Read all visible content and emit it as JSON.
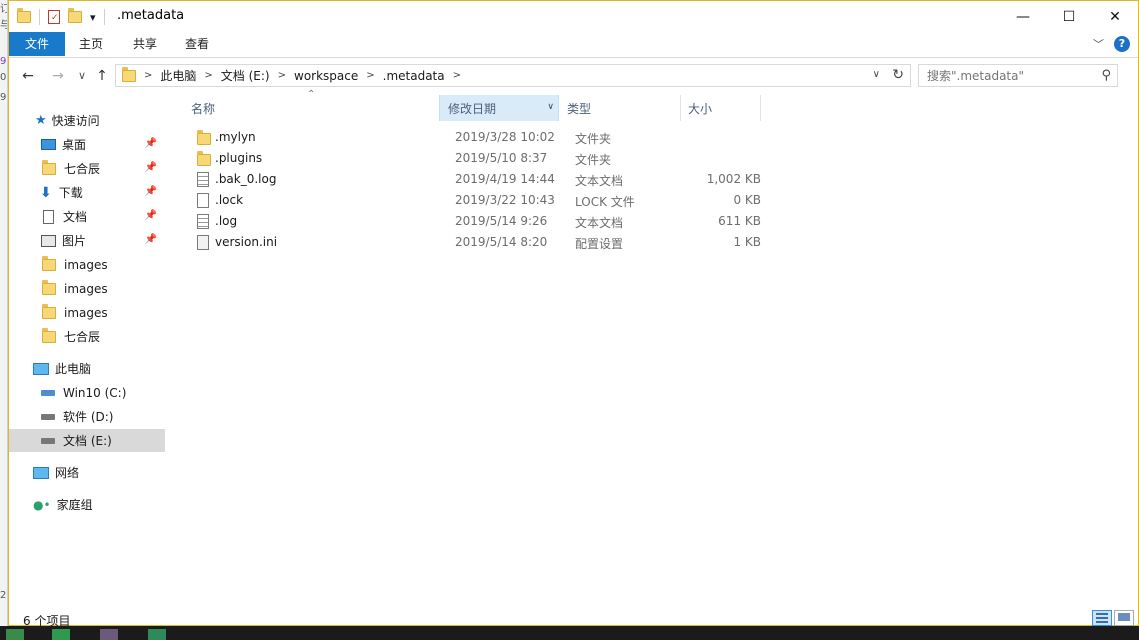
{
  "window": {
    "title": ".metadata",
    "controls": {
      "minimize": "—",
      "maximize": "☐",
      "close": "✕"
    }
  },
  "quick_access_toolbar": {
    "dropdown": "▾"
  },
  "ribbon": {
    "tabs": [
      "文件",
      "主页",
      "共享",
      "查看"
    ],
    "expand": "﹀",
    "help": "?",
    "file_tab_color": "#1979ca"
  },
  "navigation": {
    "back": "←",
    "forward": "→",
    "up": "↑"
  },
  "address": {
    "crumbs": [
      "此电脑",
      "文档 (E:)",
      "workspace",
      ".metadata"
    ],
    "separator": ">",
    "dropdown": "∨",
    "refresh": "↻"
  },
  "search": {
    "placeholder": "搜索\".metadata\"",
    "icon": "search-icon"
  },
  "nav_pane": {
    "quick_access": "快速访问",
    "pinned": [
      {
        "label": "桌面",
        "icon": "desktop-icon"
      },
      {
        "label": "七合辰",
        "icon": "folder-icon"
      },
      {
        "label": "下载",
        "icon": "download-icon"
      },
      {
        "label": "文档",
        "icon": "document-icon"
      },
      {
        "label": "图片",
        "icon": "picture-icon"
      }
    ],
    "recent": [
      "images",
      "images",
      "images",
      "七合辰"
    ],
    "this_pc": "此电脑",
    "drives": [
      "Win10 (C:)",
      "软件 (D:)",
      "文档 (E:)"
    ],
    "network": "网络",
    "homegroup": "家庭组"
  },
  "columns": {
    "name": "名称",
    "date": "修改日期",
    "type": "类型",
    "size": "大小"
  },
  "files": [
    {
      "name": ".mylyn",
      "date": "2019/3/28 10:02",
      "type": "文件夹",
      "size": "",
      "icon": "folder-icon"
    },
    {
      "name": ".plugins",
      "date": "2019/5/10 8:37",
      "type": "文件夹",
      "size": "",
      "icon": "folder-icon"
    },
    {
      "name": ".bak_0.log",
      "date": "2019/4/19 14:44",
      "type": "文本文档",
      "size": "1,002 KB",
      "icon": "text-file-icon"
    },
    {
      "name": ".lock",
      "date": "2019/3/22 10:43",
      "type": "LOCK 文件",
      "size": "0 KB",
      "icon": "file-icon"
    },
    {
      "name": ".log",
      "date": "2019/5/14 9:26",
      "type": "文本文档",
      "size": "611 KB",
      "icon": "text-file-icon"
    },
    {
      "name": "version.ini",
      "date": "2019/5/14 8:20",
      "type": "配置设置",
      "size": "1 KB",
      "icon": "config-file-icon"
    }
  ],
  "status": {
    "item_count": "6 个项目"
  }
}
